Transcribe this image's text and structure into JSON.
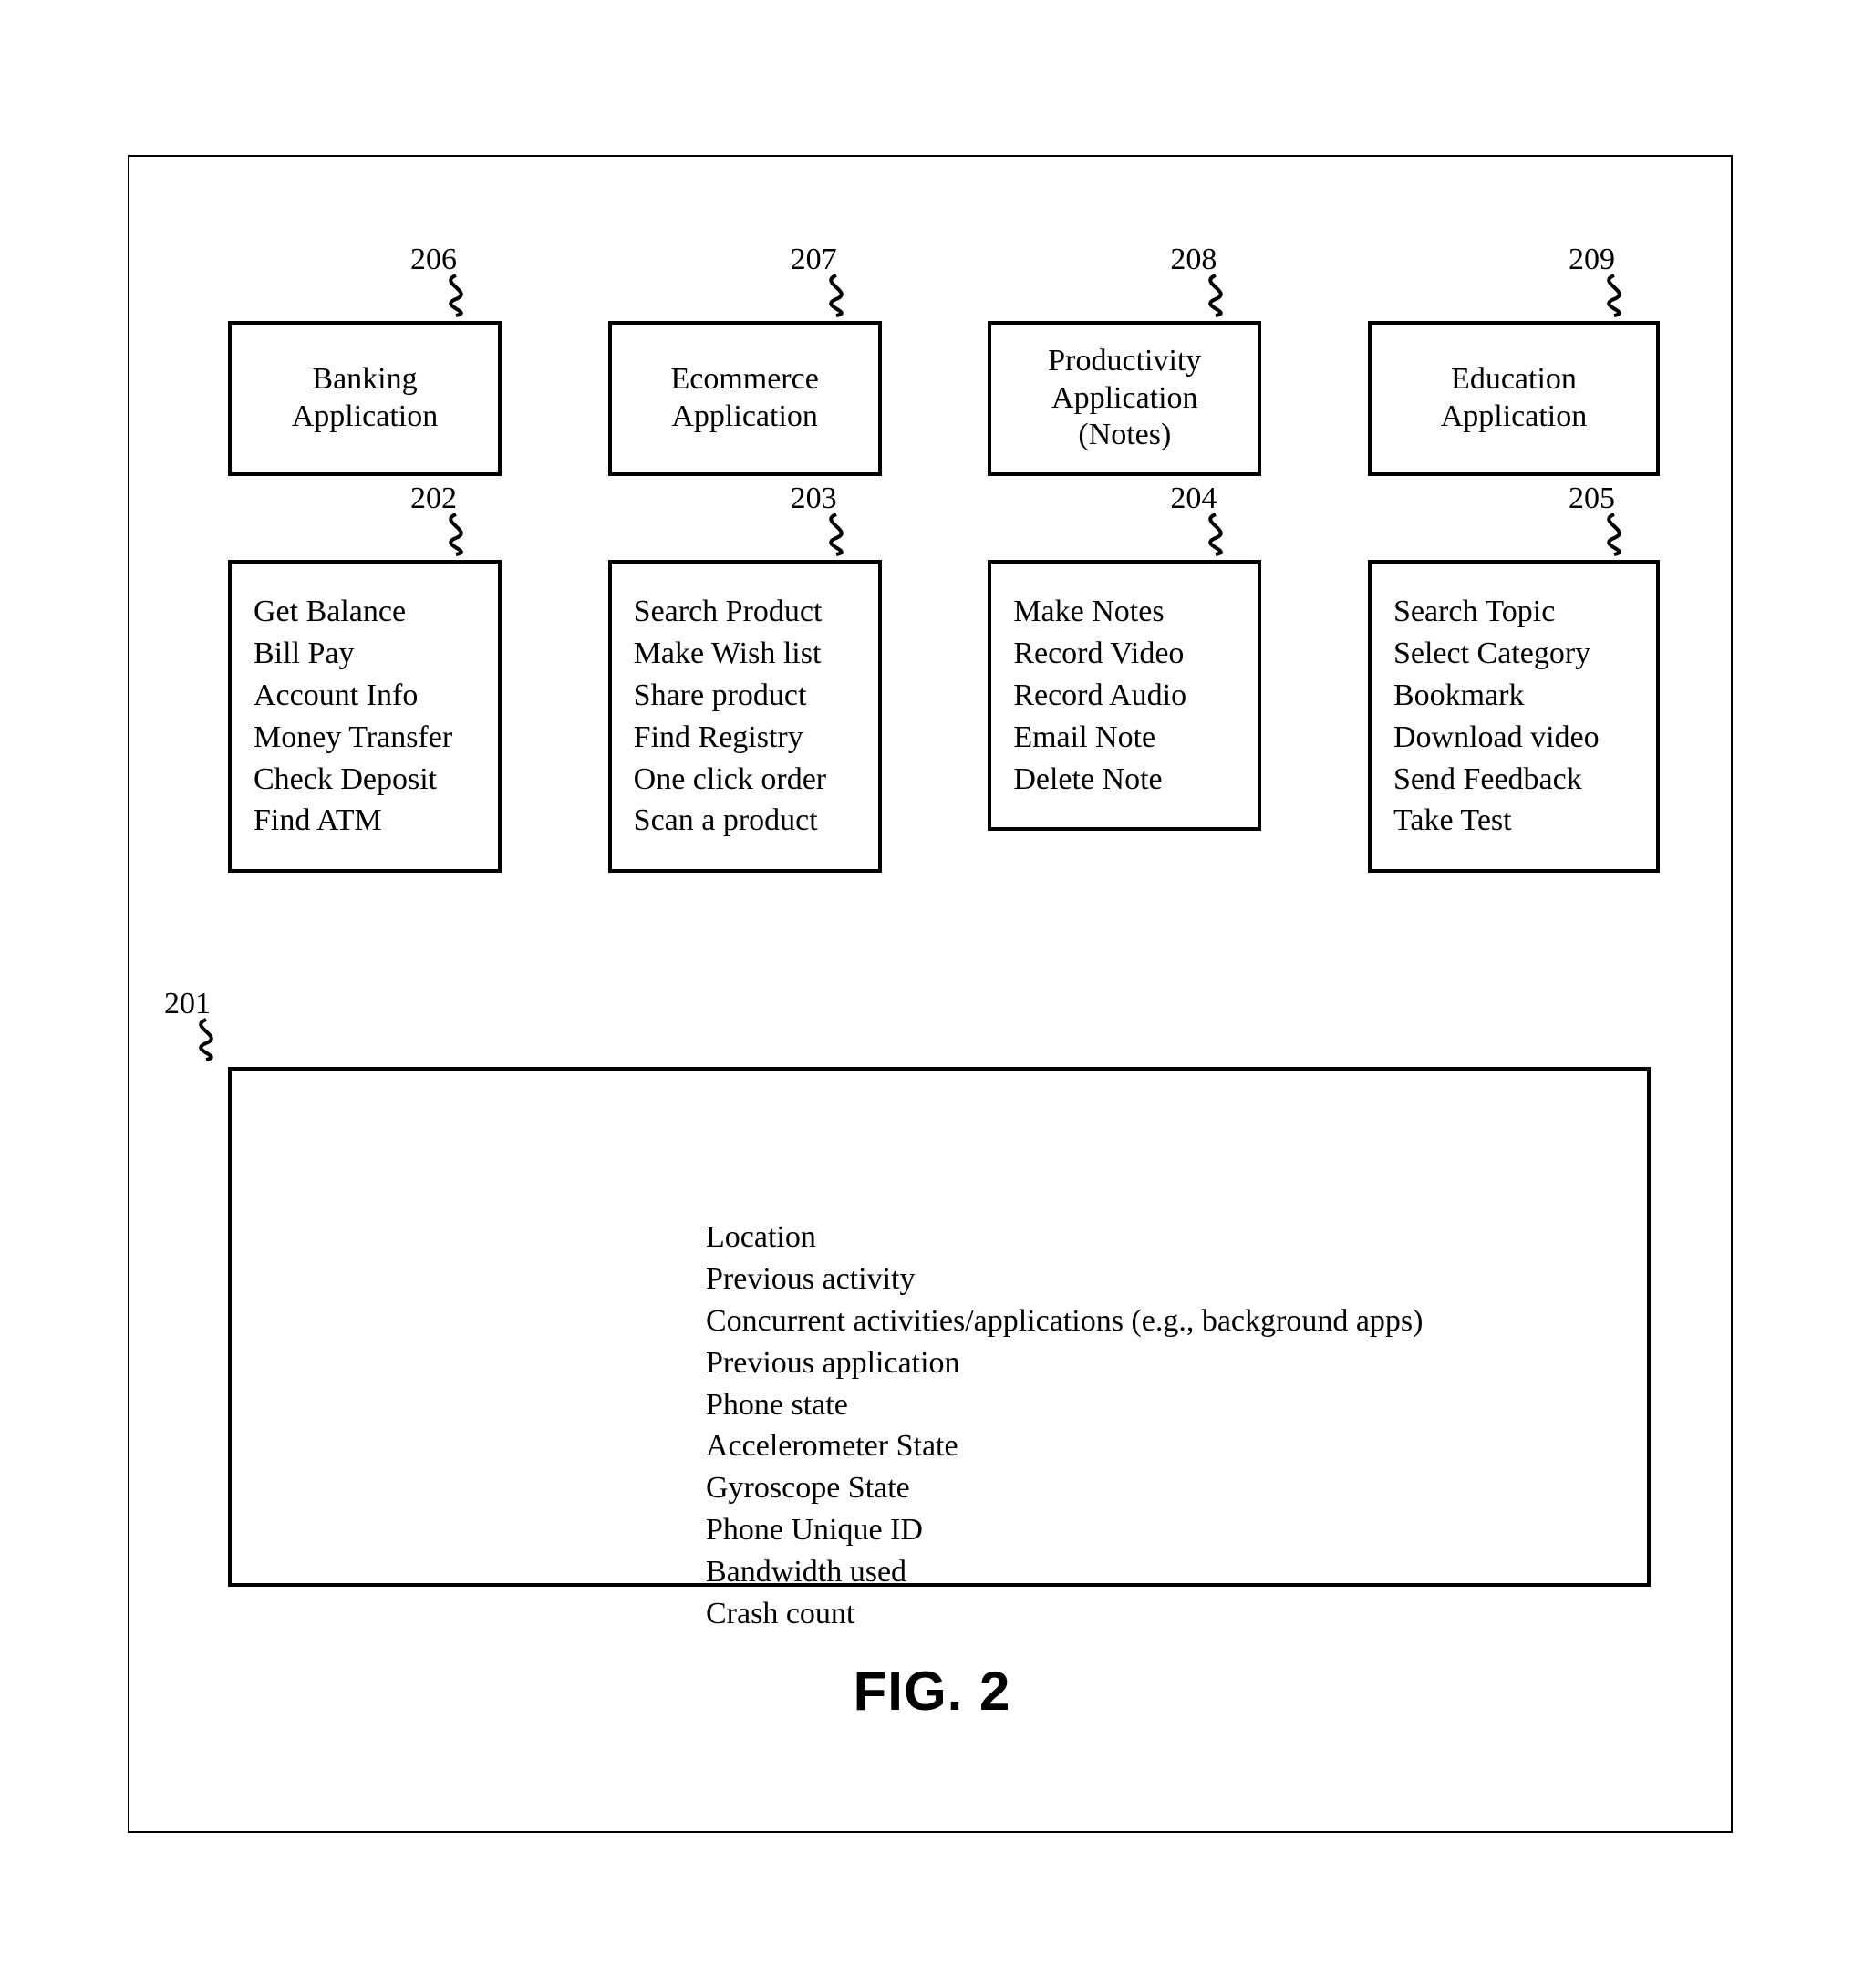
{
  "figure_caption": "FIG. 2",
  "refs": {
    "banking_title": "206",
    "ecommerce_title": "207",
    "productivity_title": "208",
    "education_title": "209",
    "banking_tasks": "202",
    "ecommerce_tasks": "203",
    "productivity_tasks": "204",
    "education_tasks": "205",
    "shared": "201"
  },
  "columns": [
    {
      "id": "banking",
      "title": "Banking\nApplication",
      "title_ref": "206",
      "tasks_ref": "202",
      "tasks": [
        "Get Balance",
        "Bill Pay",
        "Account Info",
        "Money Transfer",
        "Check Deposit",
        "Find ATM"
      ]
    },
    {
      "id": "ecommerce",
      "title": "Ecommerce\nApplication",
      "title_ref": "207",
      "tasks_ref": "203",
      "tasks": [
        "Search Product",
        "Make Wish list",
        "Share product",
        "Find Registry",
        "One click order",
        "Scan a product"
      ]
    },
    {
      "id": "productivity",
      "title": "Productivity\nApplication\n(Notes)",
      "title_ref": "208",
      "tasks_ref": "204",
      "tasks": [
        "Make Notes",
        "Record Video",
        "Record Audio",
        "Email Note",
        "Delete Note"
      ]
    },
    {
      "id": "education",
      "title": "Education\nApplication",
      "title_ref": "209",
      "tasks_ref": "205",
      "tasks": [
        "Search Topic",
        "Select Category",
        "Bookmark",
        "Download video",
        "Send Feedback",
        "Take Test"
      ]
    }
  ],
  "shared_ref": "201",
  "shared": [
    "Location",
    "Previous activity",
    "Concurrent activities/applications (e.g., background apps)",
    "Previous application",
    "Phone state",
    "Accelerometer State",
    "Gyroscope State",
    "Phone Unique ID",
    "Bandwidth used",
    "Crash count"
  ]
}
